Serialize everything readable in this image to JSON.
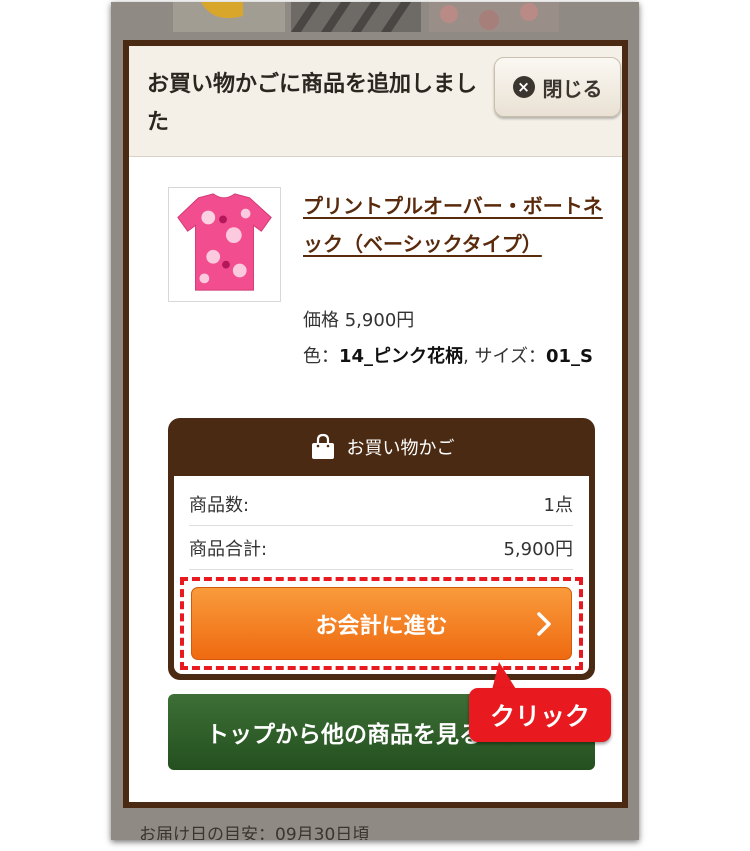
{
  "modal": {
    "title": "お買い物かごに商品を追加しました",
    "close_label": "閉じる",
    "close_icon": "close-circle-icon"
  },
  "product": {
    "name": "プリントプルオーバー・ボートネック（ベーシックタイプ）",
    "price_label": "価格",
    "price": "5,900円",
    "color_label": "色：",
    "color_value": "14_ピンク花柄",
    "size_label": ", サイズ：",
    "size_value": "01_S"
  },
  "cart": {
    "title": "お買い物かご",
    "icon": "shopping-bag-icon",
    "rows": [
      {
        "label": "商品数:",
        "value": "1点"
      },
      {
        "label": "商品合計:",
        "value": "5,900円"
      }
    ],
    "checkout_label": "お会計に進む"
  },
  "continue_button": {
    "label": "トップから他の商品を見る"
  },
  "callout": {
    "label": "クリック"
  },
  "background": {
    "delivery_text": "お届け日の目安：09月30日頃"
  },
  "colors": {
    "frame_brown": "#4a2a12",
    "checkout_orange": "#ef6a10",
    "continue_green": "#2d5a27",
    "highlight_red": "#e8191f"
  }
}
